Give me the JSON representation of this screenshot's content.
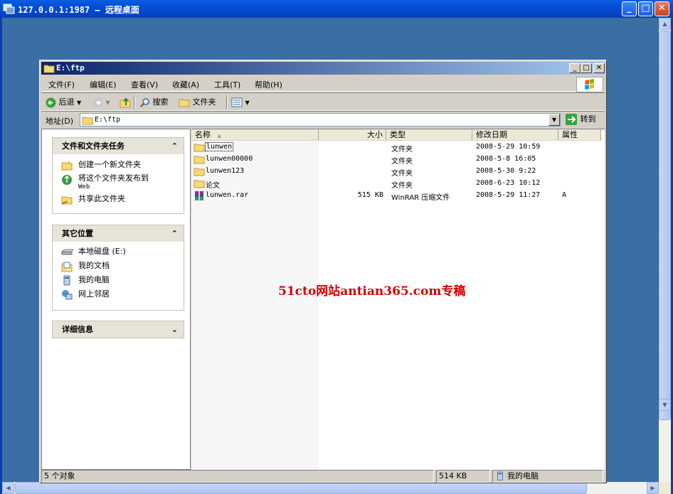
{
  "rdp": {
    "title": "127.0.0.1:1987 – 远程桌面"
  },
  "explorer": {
    "title": "E:\\ftp",
    "menu": [
      "文件(F)",
      "编辑(E)",
      "查看(V)",
      "收藏(A)",
      "工具(T)",
      "帮助(H)"
    ],
    "toolbar": {
      "back_label": "后退",
      "search_label": "搜索",
      "folders_label": "文件夹"
    },
    "address": {
      "label": "地址(D)",
      "value": "E:\\ftp",
      "go_label": "转到"
    },
    "tasks": {
      "group1_title": "文件和文件夹任务",
      "group1_items": [
        "创建一个新文件夹",
        "将这个文件夹发布到",
        "Web",
        "共享此文件夹"
      ],
      "group2_title": "其它位置",
      "group2_items": [
        "本地磁盘 (E:)",
        "我的文档",
        "我的电脑",
        "网上邻居"
      ],
      "group3_title": "详细信息"
    },
    "columns": [
      "名称",
      "大小",
      "类型",
      "修改日期",
      "属性"
    ],
    "files": [
      {
        "name": "lunwen",
        "size": "",
        "type": "文件夹",
        "date": "2008-5-29 10:59",
        "attr": ""
      },
      {
        "name": "lunwen00000",
        "size": "",
        "type": "文件夹",
        "date": "2008-5-8 16:05",
        "attr": ""
      },
      {
        "name": "lunwen123",
        "size": "",
        "type": "文件夹",
        "date": "2008-5-30 9:22",
        "attr": ""
      },
      {
        "name": "论文",
        "size": "",
        "type": "文件夹",
        "date": "2008-6-23 10:12",
        "attr": ""
      },
      {
        "name": "lunwen.rar",
        "size": "515 KB",
        "type": "WinRAR 压缩文件",
        "date": "2008-5-29 11:27",
        "attr": "A"
      }
    ],
    "watermark": "51cto网站antian365.com专稿",
    "status": {
      "count": "5 个对象",
      "size": "514 KB",
      "location": "我的电脑"
    }
  },
  "colors": {
    "desktop": "#3a6ea5",
    "xp_title": "#0450d8",
    "classic_title": "#0a246a",
    "watermark": "#d40000"
  }
}
